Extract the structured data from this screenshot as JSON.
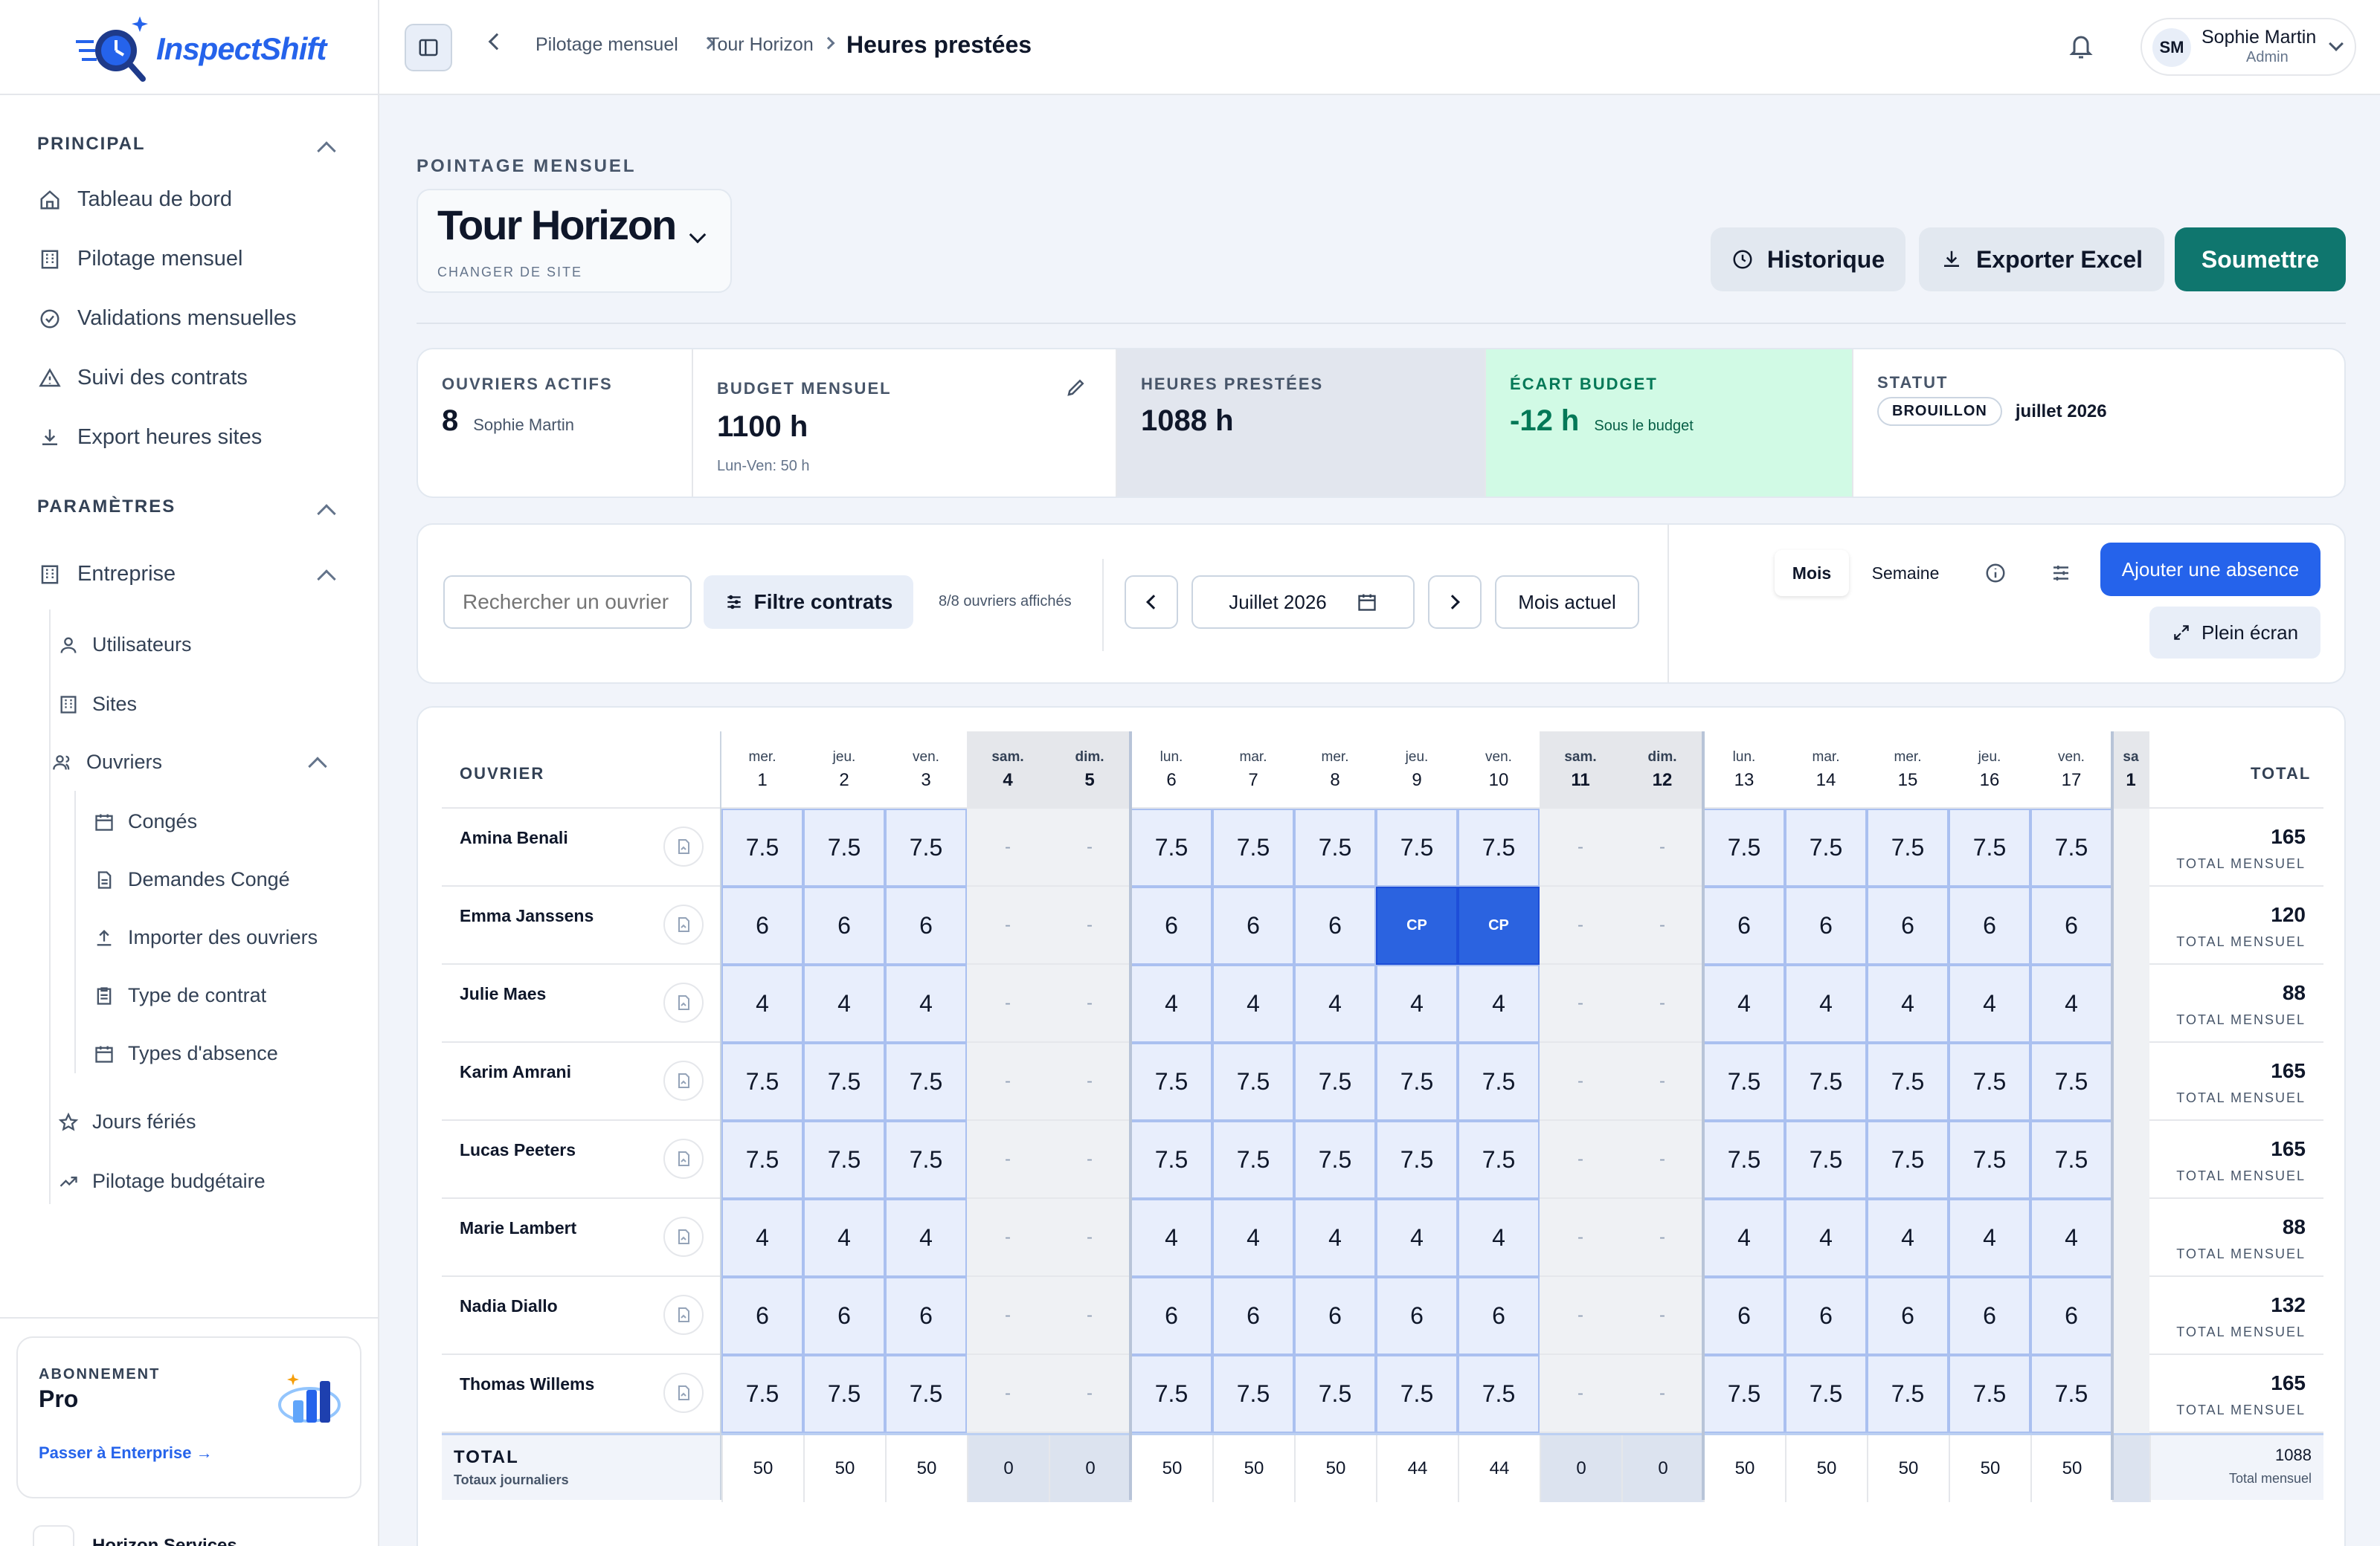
{
  "app": {
    "name": "InspectShift"
  },
  "sidebar": {
    "principal_title": "PRINCIPAL",
    "principal_items": [
      {
        "label": "Tableau de bord",
        "icon": "home-icon"
      },
      {
        "label": "Pilotage mensuel",
        "icon": "building-icon"
      },
      {
        "label": "Validations mensuelles",
        "icon": "check-circle-icon"
      },
      {
        "label": "Suivi des contrats",
        "icon": "warning-icon"
      },
      {
        "label": "Export heures sites",
        "icon": "download-icon"
      }
    ],
    "params_title": "PARAMÈTRES",
    "entreprise_label": "Entreprise",
    "entreprise_items": [
      {
        "label": "Utilisateurs",
        "icon": "user-icon"
      },
      {
        "label": "Sites",
        "icon": "building-icon"
      },
      {
        "label": "Ouvriers",
        "icon": "users-icon"
      }
    ],
    "ouvriers_items": [
      {
        "label": "Congés",
        "icon": "calendar-icon"
      },
      {
        "label": "Demandes Congé",
        "icon": "document-icon"
      },
      {
        "label": "Importer des ouvriers",
        "icon": "upload-icon"
      },
      {
        "label": "Type de contrat",
        "icon": "clipboard-icon"
      },
      {
        "label": "Types d'absence",
        "icon": "calendar-icon"
      }
    ],
    "extra_items": [
      {
        "label": "Jours fériés",
        "icon": "star-icon"
      },
      {
        "label": "Pilotage budgétaire",
        "icon": "trend-icon"
      }
    ],
    "plan": {
      "label": "ABONNEMENT",
      "name": "Pro",
      "upgrade": "Passer à Enterprise"
    },
    "company": "Horizon Services"
  },
  "topbar": {
    "breadcrumb": [
      "Pilotage mensuel",
      "Tour Horizon"
    ],
    "current": "Heures prestées",
    "user": {
      "initials": "SM",
      "name": "Sophie Martin",
      "role": "Admin"
    }
  },
  "header": {
    "eyebrow": "POINTAGE MENSUEL",
    "site": "Tour Horizon",
    "site_sub": "CHANGER DE SITE",
    "historique": "Historique",
    "exporter": "Exporter Excel",
    "soumettre": "Soumettre"
  },
  "stats": {
    "ouvriers": {
      "label": "OUVRIERS ACTIFS",
      "value": "8",
      "sub": "Sophie Martin"
    },
    "budget": {
      "label": "BUDGET MENSUEL",
      "value": "1100 h",
      "sub": "Lun-Ven: 50 h"
    },
    "heures": {
      "label": "HEURES PRESTÉES",
      "value": "1088 h"
    },
    "ecart": {
      "label": "ÉCART BUDGET",
      "value": "-12 h",
      "sub": "Sous le budget"
    },
    "statut": {
      "label": "STATUT",
      "badge": "BROUILLON",
      "period": "juillet 2026"
    }
  },
  "toolbar": {
    "search_placeholder": "Rechercher un ouvrier",
    "filter": "Filtre contrats",
    "count": "8/8 ouvriers affichés",
    "month": "Juillet 2026",
    "current_month": "Mois actuel",
    "view_month": "Mois",
    "view_week": "Semaine",
    "add_absence": "Ajouter une absence",
    "fullscreen": "Plein écran"
  },
  "grid": {
    "col_worker": "OUVRIER",
    "col_total": "TOTAL",
    "total_sub": "TOTAL MENSUEL",
    "days": [
      {
        "dw": "mer.",
        "dn": "1",
        "weekend": false
      },
      {
        "dw": "jeu.",
        "dn": "2",
        "weekend": false
      },
      {
        "dw": "ven.",
        "dn": "3",
        "weekend": false
      },
      {
        "dw": "sam.",
        "dn": "4",
        "weekend": true
      },
      {
        "dw": "dim.",
        "dn": "5",
        "weekend": true
      },
      {
        "dw": "lun.",
        "dn": "6",
        "weekend": false
      },
      {
        "dw": "mar.",
        "dn": "7",
        "weekend": false
      },
      {
        "dw": "mer.",
        "dn": "8",
        "weekend": false
      },
      {
        "dw": "jeu.",
        "dn": "9",
        "weekend": false
      },
      {
        "dw": "ven.",
        "dn": "10",
        "weekend": false
      },
      {
        "dw": "sam.",
        "dn": "11",
        "weekend": true
      },
      {
        "dw": "dim.",
        "dn": "12",
        "weekend": true
      },
      {
        "dw": "lun.",
        "dn": "13",
        "weekend": false
      },
      {
        "dw": "mar.",
        "dn": "14",
        "weekend": false
      },
      {
        "dw": "mer.",
        "dn": "15",
        "weekend": false
      },
      {
        "dw": "jeu.",
        "dn": "16",
        "weekend": false
      },
      {
        "dw": "ven.",
        "dn": "17",
        "weekend": false
      },
      {
        "dw": "sa",
        "dn": "1",
        "weekend": true
      }
    ],
    "rows": [
      {
        "name": "Amina Benali",
        "cells": [
          "7.5",
          "7.5",
          "7.5",
          "-",
          "-",
          "7.5",
          "7.5",
          "7.5",
          "7.5",
          "7.5",
          "-",
          "-",
          "7.5",
          "7.5",
          "7.5",
          "7.5",
          "7.5",
          ""
        ],
        "total": "165"
      },
      {
        "name": "Emma Janssens",
        "cells": [
          "6",
          "6",
          "6",
          "-",
          "-",
          "6",
          "6",
          "6",
          "CP",
          "CP",
          "-",
          "-",
          "6",
          "6",
          "6",
          "6",
          "6",
          ""
        ],
        "total": "120"
      },
      {
        "name": "Julie Maes",
        "cells": [
          "4",
          "4",
          "4",
          "-",
          "-",
          "4",
          "4",
          "4",
          "4",
          "4",
          "-",
          "-",
          "4",
          "4",
          "4",
          "4",
          "4",
          ""
        ],
        "total": "88"
      },
      {
        "name": "Karim Amrani",
        "cells": [
          "7.5",
          "7.5",
          "7.5",
          "-",
          "-",
          "7.5",
          "7.5",
          "7.5",
          "7.5",
          "7.5",
          "-",
          "-",
          "7.5",
          "7.5",
          "7.5",
          "7.5",
          "7.5",
          ""
        ],
        "total": "165"
      },
      {
        "name": "Lucas Peeters",
        "cells": [
          "7.5",
          "7.5",
          "7.5",
          "-",
          "-",
          "7.5",
          "7.5",
          "7.5",
          "7.5",
          "7.5",
          "-",
          "-",
          "7.5",
          "7.5",
          "7.5",
          "7.5",
          "7.5",
          ""
        ],
        "total": "165"
      },
      {
        "name": "Marie Lambert",
        "cells": [
          "4",
          "4",
          "4",
          "-",
          "-",
          "4",
          "4",
          "4",
          "4",
          "4",
          "-",
          "-",
          "4",
          "4",
          "4",
          "4",
          "4",
          ""
        ],
        "total": "88"
      },
      {
        "name": "Nadia Diallo",
        "cells": [
          "6",
          "6",
          "6",
          "-",
          "-",
          "6",
          "6",
          "6",
          "6",
          "6",
          "-",
          "-",
          "6",
          "6",
          "6",
          "6",
          "6",
          ""
        ],
        "total": "132"
      },
      {
        "name": "Thomas Willems",
        "cells": [
          "7.5",
          "7.5",
          "7.5",
          "-",
          "-",
          "7.5",
          "7.5",
          "7.5",
          "7.5",
          "7.5",
          "-",
          "-",
          "7.5",
          "7.5",
          "7.5",
          "7.5",
          "7.5",
          ""
        ],
        "total": "165"
      }
    ],
    "footer": {
      "title": "TOTAL",
      "sub": "Totaux journaliers",
      "values": [
        "50",
        "50",
        "50",
        "0",
        "0",
        "50",
        "50",
        "50",
        "44",
        "44",
        "0",
        "0",
        "50",
        "50",
        "50",
        "50",
        "50",
        ""
      ],
      "total": "1088",
      "total_sub": "Total mensuel"
    }
  }
}
